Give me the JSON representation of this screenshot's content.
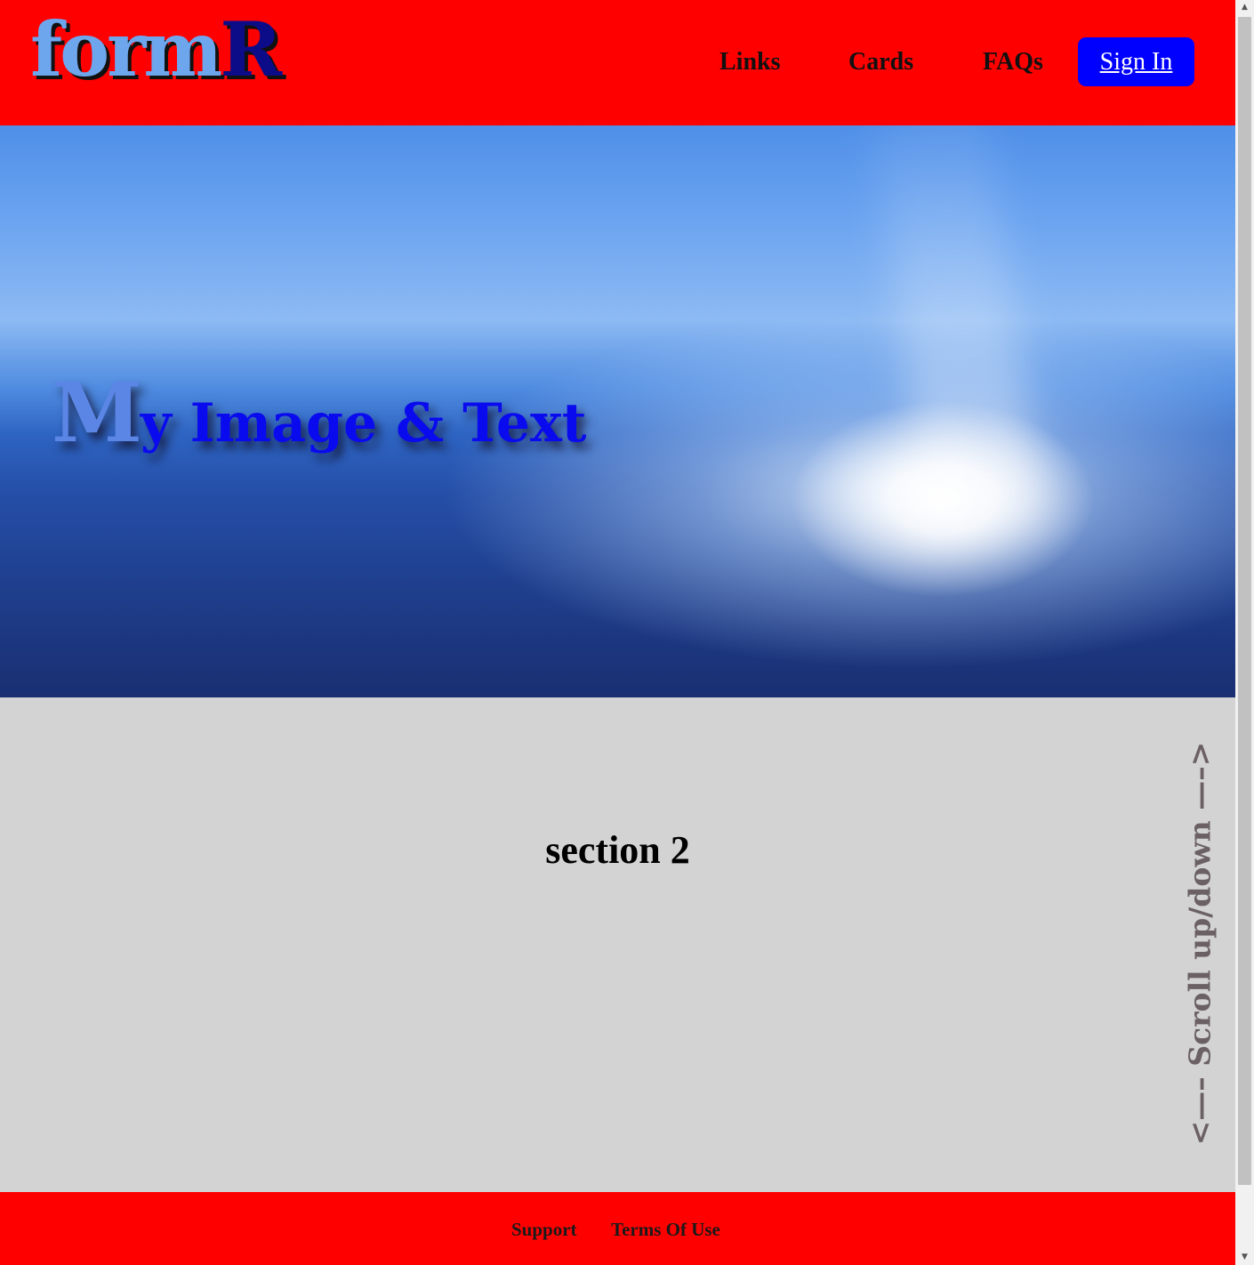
{
  "header": {
    "logo": {
      "part1": "form",
      "part2": "R"
    },
    "nav": [
      "Links",
      "Cards",
      "FAQs"
    ],
    "signin_label": "Sign In"
  },
  "hero": {
    "title_first": "M",
    "title_rest": "y Image & Text"
  },
  "section2": {
    "title": "section 2",
    "scroll_hint": "<—– Scroll up/down —–>"
  },
  "footer": {
    "links": [
      "Support",
      "Terms Of Use"
    ]
  },
  "scrollbar": {
    "up_icon": "▲",
    "down_icon": "▼"
  },
  "colors": {
    "header_bg": "#ff0000",
    "signin_bg": "#0000ff",
    "section_bg": "#d3d3d3",
    "hero_title": "#0a0aee"
  }
}
